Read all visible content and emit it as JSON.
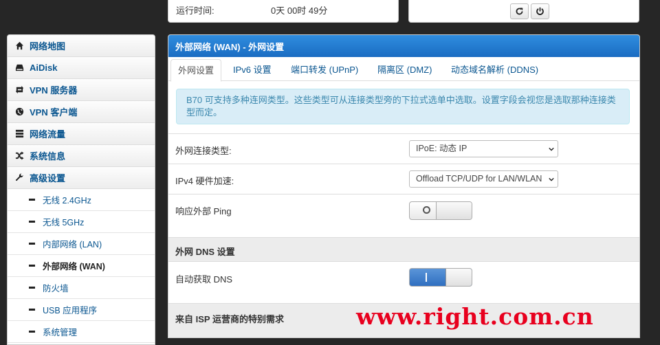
{
  "status": {
    "uptime_label": "运行时间:",
    "uptime_value": "0天 00时 49分"
  },
  "sidebar": {
    "items": [
      {
        "label": "网络地图",
        "icon": "home-icon"
      },
      {
        "label": "AiDisk",
        "icon": "hdd-icon"
      },
      {
        "label": "VPN 服务器",
        "icon": "retweet-icon"
      },
      {
        "label": "VPN 客户端",
        "icon": "globe-icon"
      },
      {
        "label": "网络流量",
        "icon": "list-icon"
      },
      {
        "label": "系统信息",
        "icon": "random-icon"
      },
      {
        "label": "高级设置",
        "icon": "wrench-icon"
      }
    ],
    "sub_items": [
      {
        "label": "无线 2.4GHz"
      },
      {
        "label": "无线 5GHz"
      },
      {
        "label": "内部网络 (LAN)"
      },
      {
        "label": "外部网络 (WAN)"
      },
      {
        "label": "防火墙"
      },
      {
        "label": "USB 应用程序"
      },
      {
        "label": "系统管理"
      }
    ],
    "active_sub": "外部网络 (WAN)"
  },
  "panel": {
    "title": "外部网络 (WAN) - 外网设置",
    "tabs": [
      {
        "label": "外网设置"
      },
      {
        "label": "IPv6 设置"
      },
      {
        "label": "端口转发 (UPnP)"
      },
      {
        "label": "隔离区 (DMZ)"
      },
      {
        "label": "动态域名解析 (DDNS)"
      }
    ],
    "info_text": "B70 可支持多种连网类型。这些类型可从连接类型旁的下拉式选单中选取。设置字段会视您是选取那种连接类型而定。",
    "wan_type_label": "外网连接类型:",
    "wan_type_value": "IPoE: 动态 IP",
    "hw_accel_label": "IPv4 硬件加速:",
    "hw_accel_value": "Offload TCP/UDP for LAN/WLAN",
    "ping_label": "响应外部 Ping",
    "ping_state": "off",
    "dns_section": "外网 DNS 设置",
    "auto_dns_label": "自动获取 DNS",
    "auto_dns_state": "on",
    "isp_section": "来自 ISP 运营商的特别需求"
  },
  "watermark": "www.right.com.cn",
  "colors": {
    "accent": "#1a6cc2",
    "link": "#0a5690",
    "info_bg": "#d9edf7",
    "watermark": "#e8001e"
  }
}
